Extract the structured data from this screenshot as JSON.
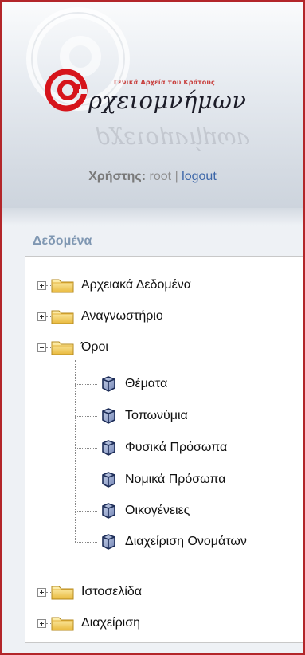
{
  "header": {
    "logo_subtitle": "Γενικά Αρχεία του Κράτους",
    "logo_word": "ρχειομνήμων",
    "user_label": "Χρήστης:",
    "user_name": "root",
    "separator": "|",
    "logout_label": "logout"
  },
  "section": {
    "title": "Δεδομένα"
  },
  "tree": {
    "archival_data": "Αρχειακά Δεδομένα",
    "reading_room": "Αναγνωστήριο",
    "terms": "Όροι",
    "terms_children": [
      "Θέματα",
      "Τοπωνύμια",
      "Φυσικά Πρόσωπα",
      "Νομικά Πρόσωπα",
      "Οικογένειες",
      "Διαχείριση Ονομάτων"
    ],
    "website": "Ιστοσελίδα",
    "administration": "Διαχείριση"
  },
  "colors": {
    "frame_border": "#b3262a",
    "link": "#3c66a8",
    "section_title": "#7f97b2",
    "folder": "#f2cf5b"
  }
}
